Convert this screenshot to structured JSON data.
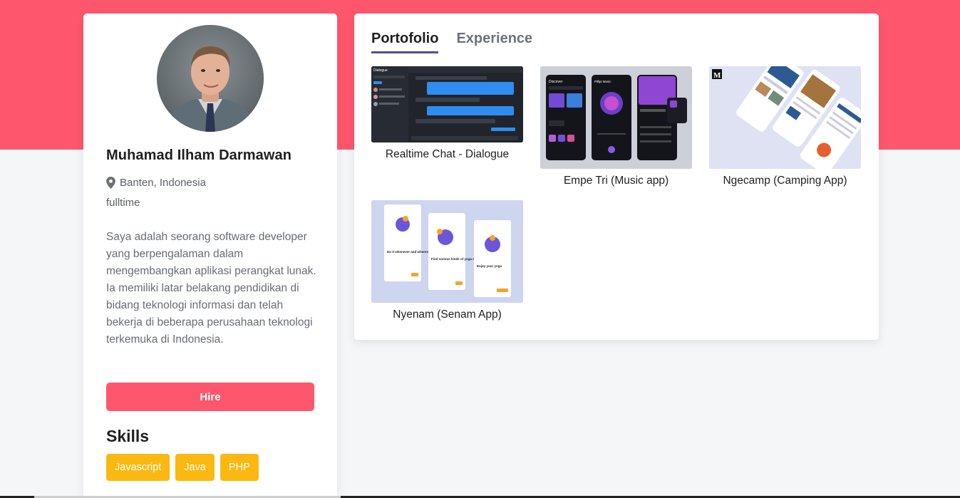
{
  "profile": {
    "name": "Muhamad Ilham Darmawan",
    "location": "Banten, Indonesia",
    "job_type": "fulltime",
    "bio": "Saya adalah seorang software developer yang berpengalaman dalam mengembangkan aplikasi perangkat lunak. Ia memiliki latar belakang pendidikan di bidang teknologi informasi dan telah bekerja di beberapa perusahaan teknologi terkemuka di Indonesia.",
    "hire_label": "Hire",
    "skills_title": "Skills",
    "skills": [
      "Javascript",
      "Java",
      "PHP"
    ]
  },
  "tabs": [
    {
      "label": "Portofolio",
      "active": true
    },
    {
      "label": "Experience",
      "active": false
    }
  ],
  "portfolio": [
    {
      "title": "Realtime Chat - Dialogue"
    },
    {
      "title": "Empe Tri (Music app)"
    },
    {
      "title": "Ngecamp (Camping App)"
    },
    {
      "title": "Nyenam (Senam App)"
    }
  ],
  "thumb_texts": {
    "dialogue_app": "Dialogue",
    "music_header": "Discover",
    "music_playlist": "Pillipi Music",
    "exercise_1": "Do it whenever and wherever",
    "exercise_2": "Find various kinds of yoga movements",
    "exercise_3": "Enjoy your yoga",
    "medium_logo": "M"
  },
  "colors": {
    "brand": "#fe576d",
    "tab_underline": "#5a4a9e",
    "skill_badge": "#fbb810"
  }
}
